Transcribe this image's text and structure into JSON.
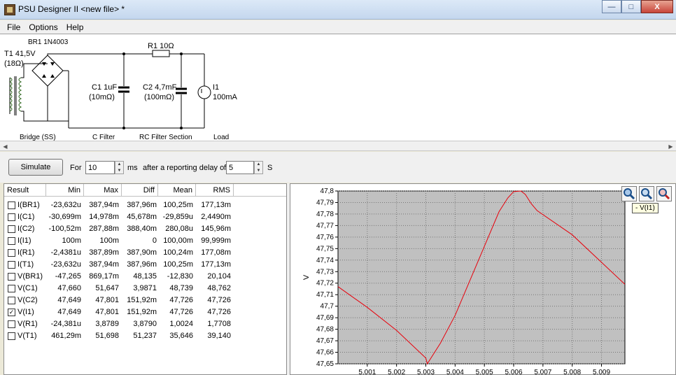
{
  "window": {
    "title": "PSU Designer II  <new file> *",
    "controls": {
      "minimize": "—",
      "maximize": "□",
      "close": "X"
    }
  },
  "menu": {
    "items": [
      "File",
      "Options",
      "Help"
    ]
  },
  "schematic": {
    "transformer": {
      "name": "T1 41,5V",
      "resistance": "(18Ω)"
    },
    "rectifier": "BR1 1N4003",
    "resistor": "R1 10Ω",
    "c1": {
      "name": "C1 1uF",
      "esr": "(10mΩ)"
    },
    "c2": {
      "name": "C2 4,7mF",
      "esr": "(100mΩ)"
    },
    "load": {
      "name": "I1",
      "value": "100mA"
    },
    "sections": [
      "Bridge (SS)",
      "C Filter",
      "RC Filter Section",
      "Load"
    ]
  },
  "controls": {
    "simulate_label": "Simulate",
    "for_label": "For",
    "duration_value": "10",
    "duration_unit": "ms",
    "delay_label": "after a reporting delay of",
    "delay_value": "5",
    "delay_unit": "S"
  },
  "results": {
    "columns": [
      "Result",
      "Min",
      "Max",
      "Diff",
      "Mean",
      "RMS"
    ],
    "rows": [
      {
        "name": "I(BR1)",
        "min": "-23,632u",
        "max": "387,94m",
        "diff": "387,96m",
        "mean": "100,25m",
        "rms": "177,13m",
        "checked": false
      },
      {
        "name": "I(C1)",
        "min": "-30,699m",
        "max": "14,978m",
        "diff": "45,678m",
        "mean": "-29,859u",
        "rms": "2,4490m",
        "checked": false
      },
      {
        "name": "I(C2)",
        "min": "-100,52m",
        "max": "287,88m",
        "diff": "388,40m",
        "mean": "280,08u",
        "rms": "145,96m",
        "checked": false
      },
      {
        "name": "I(I1)",
        "min": "100m",
        "max": "100m",
        "diff": "0",
        "mean": "100,00m",
        "rms": "99,999m",
        "checked": false
      },
      {
        "name": "I(R1)",
        "min": "-2,4381u",
        "max": "387,89m",
        "diff": "387,90m",
        "mean": "100,24m",
        "rms": "177,08m",
        "checked": false
      },
      {
        "name": "I(T1)",
        "min": "-23,632u",
        "max": "387,94m",
        "diff": "387,96m",
        "mean": "100,25m",
        "rms": "177,13m",
        "checked": false
      },
      {
        "name": "V(BR1)",
        "min": "-47,265",
        "max": "869,17m",
        "diff": "48,135",
        "mean": "-12,830",
        "rms": "20,104",
        "checked": false
      },
      {
        "name": "V(C1)",
        "min": "47,660",
        "max": "51,647",
        "diff": "3,9871",
        "mean": "48,739",
        "rms": "48,762",
        "checked": false
      },
      {
        "name": "V(C2)",
        "min": "47,649",
        "max": "47,801",
        "diff": "151,92m",
        "mean": "47,726",
        "rms": "47,726",
        "checked": false
      },
      {
        "name": "V(I1)",
        "min": "47,649",
        "max": "47,801",
        "diff": "151,92m",
        "mean": "47,726",
        "rms": "47,726",
        "checked": true
      },
      {
        "name": "V(R1)",
        "min": "-24,381u",
        "max": "3,8789",
        "diff": "3,8790",
        "mean": "1,0024",
        "rms": "1,7708",
        "checked": false
      },
      {
        "name": "V(T1)",
        "min": "461,29m",
        "max": "51,698",
        "diff": "51,237",
        "mean": "35,646",
        "rms": "39,140",
        "checked": false
      }
    ]
  },
  "chart": {
    "tooltip": "- V(I1)",
    "zoom_icons": [
      "zoom-in-icon",
      "zoom-icon",
      "zoom-reset-icon"
    ],
    "line_color": "#e8000b"
  },
  "chart_data": {
    "type": "line",
    "ylabel": "V",
    "xlabel": "",
    "ylim": [
      47.65,
      47.8
    ],
    "xlim": [
      5.0,
      5.0098
    ],
    "y_ticks": [
      "47,8",
      "47,79",
      "47,78",
      "47,77",
      "47,76",
      "47,75",
      "47,74",
      "47,73",
      "47,72",
      "47,71",
      "47,7",
      "47,69",
      "47,68",
      "47,67",
      "47,66",
      "47,65"
    ],
    "x_ticks": [
      "5,001",
      "5,002",
      "5,003",
      "5,004",
      "5,005",
      "5,006",
      "5,007",
      "5,008",
      "5,009"
    ],
    "series": [
      {
        "x": [
          5.0,
          5.001,
          5.002,
          5.003,
          5.00305,
          5.0035,
          5.004,
          5.005,
          5.0055,
          5.0058,
          5.006,
          5.00625,
          5.0064,
          5.0066,
          5.0068,
          5.008,
          5.0098
        ],
        "y": [
          47.717,
          47.699,
          47.679,
          47.655,
          47.65,
          47.668,
          47.692,
          47.752,
          47.782,
          47.794,
          47.7995,
          47.8,
          47.797,
          47.789,
          47.783,
          47.762,
          47.719
        ]
      }
    ],
    "grid": true,
    "legend": "none"
  }
}
